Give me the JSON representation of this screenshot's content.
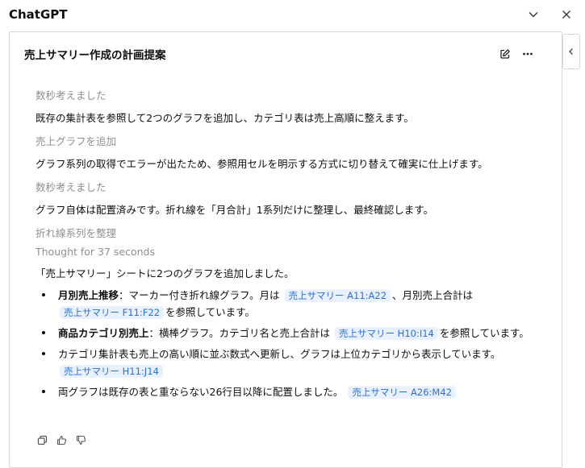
{
  "app": {
    "title": "ChatGPT"
  },
  "conversation": {
    "title": "売上サマリー作成の計画提案"
  },
  "steps": [
    {
      "label": "数秒考えました",
      "text": "既存の集計表を参照して2つのグラフを追加し、カテゴリ表は売上高順に整えます。"
    },
    {
      "label": "売上グラフを追加",
      "text": "グラフ系列の取得でエラーが出たため、参照用セルを明示する方式に切り替えて確実に仕上げます。"
    },
    {
      "label": "数秒考えました",
      "text": "グラフ自体は配置済みです。折れ線を「月合計」1系列だけに整理し、最終確認します。"
    },
    {
      "label": "折れ線系列を整理"
    }
  ],
  "thought": "Thought for 37 seconds",
  "summary": "「売上サマリー」シートに2つのグラフを追加しました。",
  "bullets": [
    {
      "bold": "月別売上推移",
      "t1": "：マーカー付き折れ線グラフ。月は",
      "chip1": "売上サマリー A11:A22",
      "t2": "、月別売上合計は",
      "chip2": "売上サマリー F11:F22",
      "t3": "を参照しています。"
    },
    {
      "bold": "商品カテゴリ別売上",
      "t1": "：横棒グラフ。カテゴリ名と売上合計は",
      "chip1": "売上サマリー H10:I14",
      "t2": "を参照しています。"
    },
    {
      "t1": "カテゴリ集計表も売上の高い順に並ぶ数式へ更新し、グラフは上位カテゴリから表示しています。",
      "chip1": "売上サマリー H11:J14"
    },
    {
      "t1": "両グラフは既存の表と重ならない26行目以降に配置しました。",
      "chip1": "売上サマリー A26:M42"
    }
  ],
  "icons": {
    "collapse": "chevron-down-icon",
    "close": "close-icon",
    "side": "chevron-left-icon",
    "edit": "edit-icon",
    "more": "more-icon",
    "copy": "copy-icon",
    "like": "thumbs-up-icon",
    "dislike": "thumbs-down-icon"
  },
  "colors": {
    "chip_bg": "#e8f1fd",
    "chip_text": "#2a6fd6",
    "muted": "#8f8f8f"
  }
}
